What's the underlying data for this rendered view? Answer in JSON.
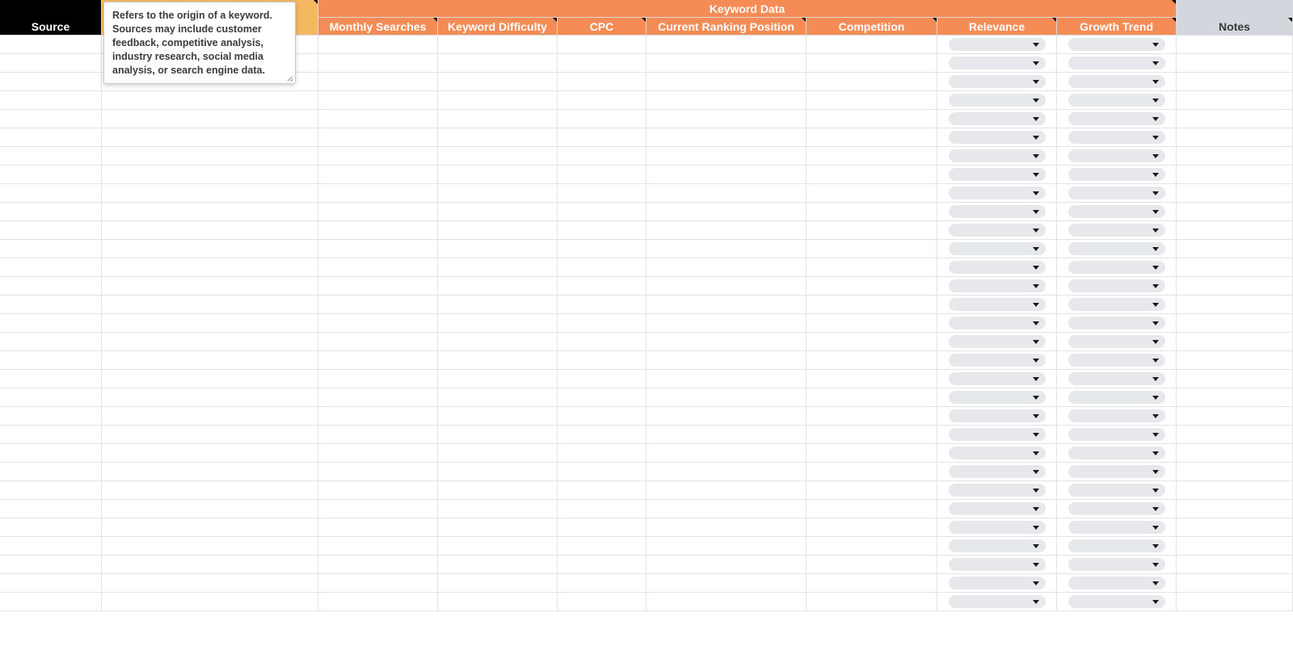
{
  "header": {
    "source": "Source",
    "keyword_data_group": "Keyword Data",
    "columns": {
      "monthly_searches": "Monthly Searches",
      "keyword_difficulty": "Keyword Difficulty",
      "cpc": "CPC",
      "current_ranking_position": "Current Ranking Position",
      "competition": "Competition",
      "relevance": "Relevance",
      "growth_trend": "Growth Trend",
      "notes": "Notes"
    }
  },
  "tooltip": {
    "text": "Refers to the origin of a keyword. Sources may include customer feedback, competitive analysis, industry research, social media analysis, or search engine data."
  },
  "row_count": 31,
  "dropdown_columns": [
    "relevance",
    "growth_trend"
  ]
}
